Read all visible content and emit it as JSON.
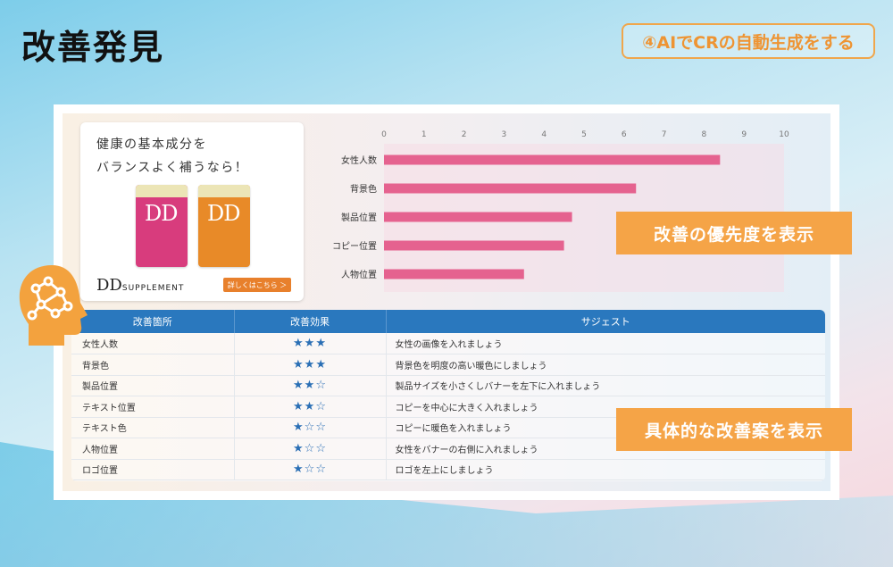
{
  "title": "改善発見",
  "step_badge": "④AIでCRの自動生成をする",
  "ad": {
    "headline": "健康の基本成分を\nバランスよく補うなら！",
    "bottle_label": "DD",
    "brand_main": "DD",
    "brand_sub": "SUPPLEMENT",
    "cta": "詳しくはこちら ＞"
  },
  "callouts": {
    "priority": "改善の優先度を表示",
    "suggestion": "具体的な改善案を表示"
  },
  "colors": {
    "bar": "#e5628f",
    "accent": "#f5a447",
    "table_header": "#2a78be",
    "ai_icon": "#f3a23e"
  },
  "chart_data": {
    "type": "bar",
    "orientation": "horizontal",
    "categories": [
      "女性人数",
      "背景色",
      "製品位置",
      "コピー位置",
      "人物位置"
    ],
    "values": [
      8.4,
      6.3,
      4.7,
      4.5,
      3.5
    ],
    "xlim": [
      0,
      10
    ],
    "xticks": [
      "0",
      "1",
      "2",
      "3",
      "4",
      "5",
      "6",
      "7",
      "8",
      "9",
      "10"
    ],
    "grid": false,
    "legend": "none"
  },
  "table": {
    "headers": [
      "改善箇所",
      "改善効果",
      "サジェスト"
    ],
    "rows": [
      {
        "area": "女性人数",
        "effect": "★★★",
        "suggest": "女性の画像を入れましょう"
      },
      {
        "area": "背景色",
        "effect": "★★★",
        "suggest": "背景色を明度の高い暖色にしましょう"
      },
      {
        "area": "製品位置",
        "effect": "★★☆",
        "suggest": "製品サイズを小さくしバナーを左下に入れましょう"
      },
      {
        "area": "テキスト位置",
        "effect": "★★☆",
        "suggest": "コピーを中心に大きく入れましょう"
      },
      {
        "area": "テキスト色",
        "effect": "★☆☆",
        "suggest": "コピーに暖色を入れましょう"
      },
      {
        "area": "人物位置",
        "effect": "★☆☆",
        "suggest": "女性をバナーの右側に入れましょう"
      },
      {
        "area": "ロゴ位置",
        "effect": "★☆☆",
        "suggest": "ロゴを左上にしましょう"
      }
    ]
  }
}
